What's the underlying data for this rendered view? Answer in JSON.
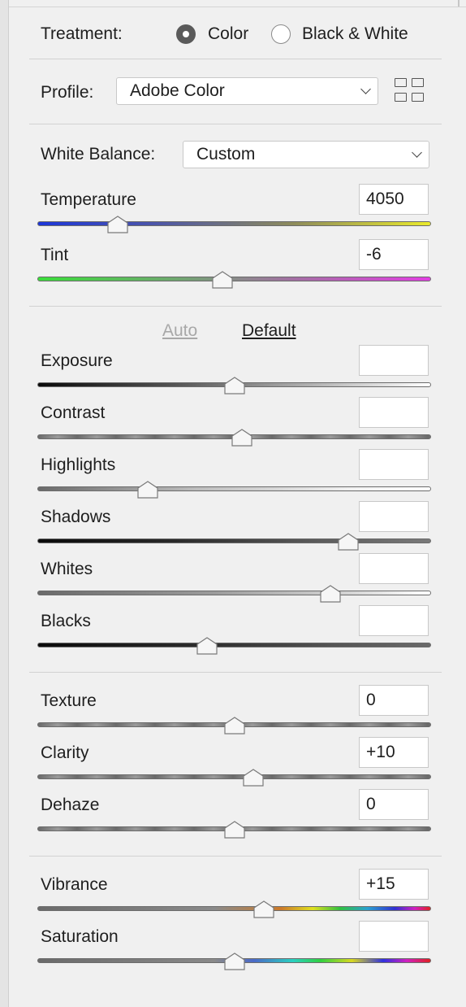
{
  "treatment": {
    "label": "Treatment:",
    "options": [
      "Color",
      "Black & White"
    ],
    "selected": "Color"
  },
  "profile": {
    "label": "Profile:",
    "value": "Adobe Color",
    "browser_icon": "grid-icon"
  },
  "white_balance": {
    "label": "White Balance:",
    "value": "Custom"
  },
  "tone_buttons": {
    "auto": "Auto",
    "default": "Default"
  },
  "sliders": [
    {
      "key": "temperature",
      "label": "Temperature",
      "value": "4050",
      "position": 0.205,
      "gradient": "linear-gradient(90deg,#1c36d8 0%,#4d56a8 30%,#8e8c5c 65%,#eaea2c 100%)"
    },
    {
      "key": "tint",
      "label": "Tint",
      "value": "-6",
      "position": 0.47,
      "gradient": "linear-gradient(90deg,#3ade3a 0%,#6fa86f 35%,#a36fa3 65%,#e23ee2 100%)"
    },
    {
      "key": "exposure",
      "label": "Exposure",
      "value": "",
      "position": 0.5,
      "gradient": "linear-gradient(90deg,#0a0a0a 0%,#555 35%,#9a9a9a 60%,#ffffff 100%)"
    },
    {
      "key": "contrast",
      "label": "Contrast",
      "value": "",
      "position": 0.52,
      "gradient": "repeating-linear-gradient(90deg,#6a6a6a 0px,#9a9a9a 24px,#6a6a6a 48px)"
    },
    {
      "key": "highlights",
      "label": "Highlights",
      "value": "",
      "position": 0.28,
      "gradient": "linear-gradient(90deg,#6a6a6a 0%,#bdbdbd 40%,#f2f2f2 80%,#ffffff 100%)"
    },
    {
      "key": "shadows",
      "label": "Shadows",
      "value": "",
      "position": 0.79,
      "gradient": "linear-gradient(90deg,#0a0a0a 0%,#2a2a2a 35%,#5a5a5a 70%,#7a7a7a 100%)"
    },
    {
      "key": "whites",
      "label": "Whites",
      "value": "",
      "position": 0.745,
      "gradient": "linear-gradient(90deg,#6a6a6a 0%,#9c9c9c 45%,#d6d6d6 80%,#ffffff 100%)"
    },
    {
      "key": "blacks",
      "label": "Blacks",
      "value": "",
      "position": 0.43,
      "gradient": "linear-gradient(90deg,#0a0a0a 0%,#303030 45%,#555 75%,#6a6a6a 100%)"
    },
    {
      "key": "texture",
      "label": "Texture",
      "value": "0",
      "position": 0.5,
      "gradient": "repeating-linear-gradient(90deg,#6a6a6a 0px,#9a9a9a 24px,#6a6a6a 48px)"
    },
    {
      "key": "clarity",
      "label": "Clarity",
      "value": "+10",
      "position": 0.548,
      "gradient": "repeating-linear-gradient(90deg,#6a6a6a 0px,#9a9a9a 24px,#6a6a6a 48px)"
    },
    {
      "key": "dehaze",
      "label": "Dehaze",
      "value": "0",
      "position": 0.5,
      "gradient": "repeating-linear-gradient(90deg,#6a6a6a 0px,#9a9a9a 24px,#6a6a6a 48px)"
    },
    {
      "key": "vibrance",
      "label": "Vibrance",
      "value": "+15",
      "position": 0.575,
      "gradient": "linear-gradient(90deg,#6a6a6a 0%,#8a8a8a 45%,#cc7a2a 62%,#e0e020 70%,#30c040 77%,#2aa0d0 84%,#3030d0 91%,#d020c0 96%,#e02020 100%)"
    },
    {
      "key": "saturation",
      "label": "Saturation",
      "value": "",
      "position": 0.5,
      "gradient": "linear-gradient(90deg,#6a6a6a 0%,#8a8a8a 45%,#4a6ac8 55%,#2ad0c0 65%,#30d040 72%,#d8d820 80%,#3030e0 88%,#d020c0 94%,#e02020 100%)"
    }
  ]
}
